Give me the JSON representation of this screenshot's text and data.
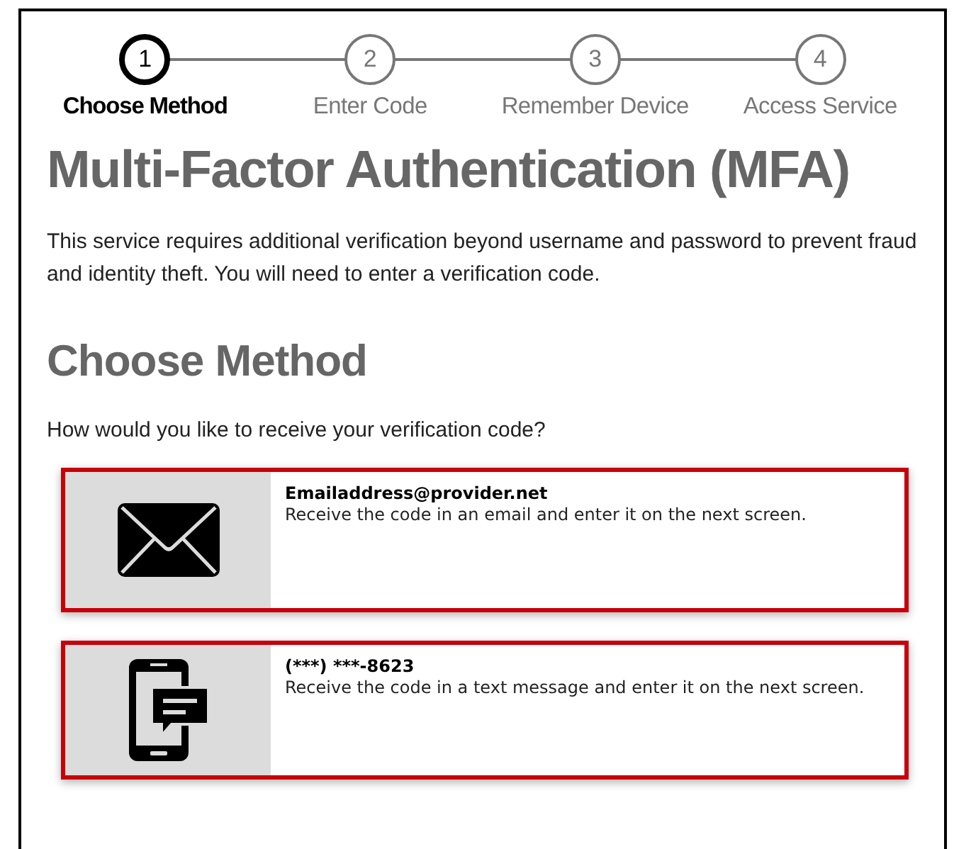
{
  "steps": [
    {
      "number": "1",
      "label": "Choose Method",
      "selected": true
    },
    {
      "number": "2",
      "label": "Enter Code",
      "selected": false
    },
    {
      "number": "3",
      "label": "Remember Device",
      "selected": false
    },
    {
      "number": "4",
      "label": "Access Service",
      "selected": false
    }
  ],
  "title": "Multi-Factor Authentication (MFA)",
  "intro": "This service requires additional verification beyond username and password to prevent fraud and identity theft. You will need to enter a verification code.",
  "section_title": "Choose Method",
  "question": "How would you like to receive your verification code?",
  "methods": [
    {
      "kind": "email",
      "contact": "Emailaddress@provider.net",
      "description": "Receive the code in an email and enter it on the next screen."
    },
    {
      "kind": "sms",
      "contact": "(***) ***-8623",
      "description": "Receive the code in a text message and enter it on the next screen."
    }
  ]
}
